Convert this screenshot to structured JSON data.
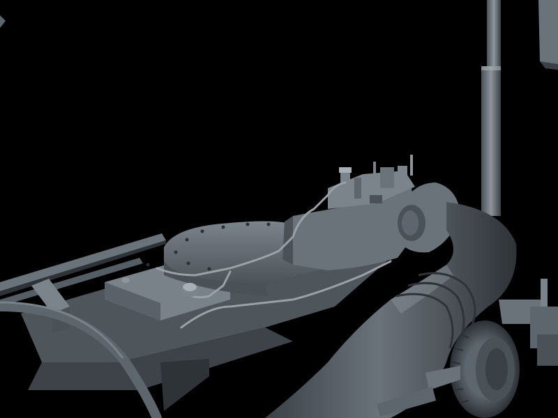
{
  "scene": {
    "subject": "3d-render-machinery",
    "render_style": "grey-clay-shaded",
    "background_color": "#000000",
    "palette": {
      "light": "#8d959c",
      "mid": "#5e666d",
      "dark": "#3a4046",
      "deep": "#262a2e",
      "highlight": "#a8b0b6"
    }
  }
}
